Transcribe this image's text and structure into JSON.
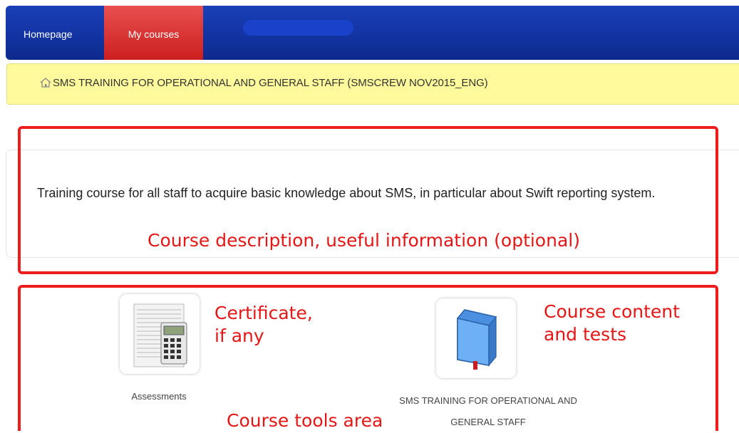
{
  "nav": {
    "items": [
      "Homepage",
      "My courses"
    ],
    "active": "My courses",
    "colors": {
      "bar": "#1232a0",
      "active": "#cc1f1f"
    }
  },
  "breadcrumb": {
    "icon": "home-icon",
    "text": "SMS TRAINING FOR OPERATIONAL AND GENERAL STAFF (SMSCREW NOV2015_ENG)"
  },
  "course": {
    "description": "Training course for all staff to acquire basic knowledge about SMS, in particular about Swift reporting system."
  },
  "annotations": {
    "description": "Course description, useful information (optional)",
    "certificate_line1": "Certificate,",
    "certificate_line2": "if any",
    "content_line1": "Course content",
    "content_line2": "and tests",
    "tools_area": "Course tools area",
    "color": "#ee1c1c"
  },
  "tools": [
    {
      "icon": "calculator-spreadsheet-icon",
      "label": "Assessments"
    },
    {
      "icon": "blue-book-icon",
      "label_line1": "SMS TRAINING FOR OPERATIONAL AND",
      "label_line2": "GENERAL STAFF"
    }
  ]
}
